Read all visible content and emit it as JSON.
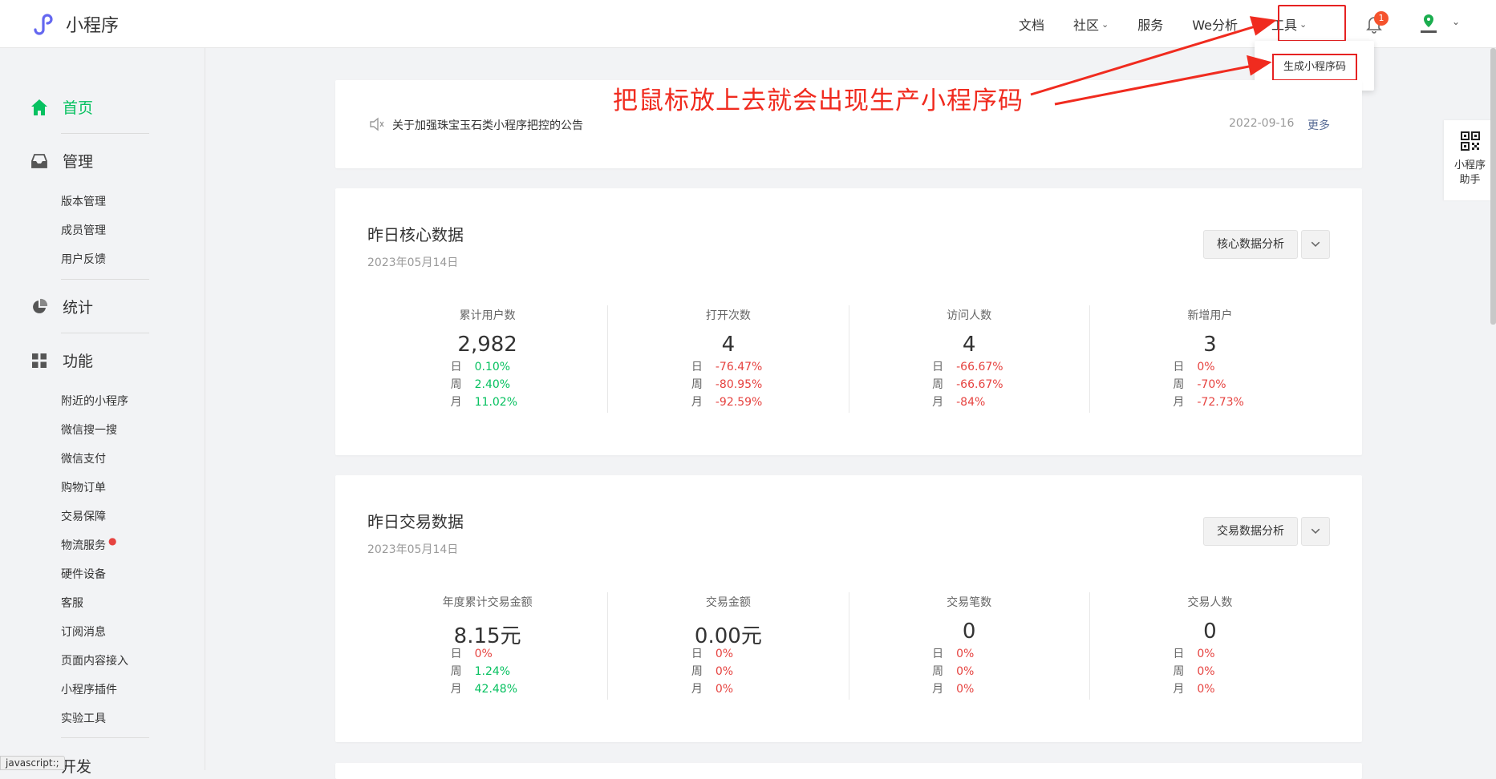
{
  "app": {
    "name": "小程序"
  },
  "nav": {
    "docs": "文档",
    "community": "社区",
    "service": "服务",
    "we_analysis": "We分析",
    "tools": "工具",
    "notification_count": "1"
  },
  "tools_menu": {
    "generate_qrcode": "生成小程序码"
  },
  "annotation": {
    "text": "把鼠标放上去就会出现生产小程序码",
    "color": "#f02b1f"
  },
  "sidebar": {
    "home": "首页",
    "manage": "管理",
    "manage_items": [
      "版本管理",
      "成员管理",
      "用户反馈"
    ],
    "stats": "统计",
    "features": "功能",
    "feature_items": [
      "附近的小程序",
      "微信搜一搜",
      "微信支付",
      "购物订单",
      "交易保障",
      "物流服务",
      "硬件设备",
      "客服",
      "订阅消息",
      "页面内容接入",
      "小程序插件",
      "实验工具"
    ],
    "develop": "开发"
  },
  "status_tip": "javascript:;",
  "notice": {
    "text": "关于加强珠宝玉石类小程序把控的公告",
    "date": "2022-09-16",
    "more": "更多"
  },
  "core": {
    "title": "昨日核心数据",
    "date": "2023年05月14日",
    "button": "核心数据分析",
    "metrics": [
      {
        "label": "累计用户数",
        "value": "2,982",
        "day": "0.10%",
        "week": "2.40%",
        "month": "11.02%",
        "dir": [
          "up",
          "up",
          "up"
        ]
      },
      {
        "label": "打开次数",
        "value": "4",
        "day": "-76.47%",
        "week": "-80.95%",
        "month": "-92.59%",
        "dir": [
          "down",
          "down",
          "down"
        ]
      },
      {
        "label": "访问人数",
        "value": "4",
        "day": "-66.67%",
        "week": "-66.67%",
        "month": "-84%",
        "dir": [
          "down",
          "down",
          "down"
        ]
      },
      {
        "label": "新增用户",
        "value": "3",
        "day": "0%",
        "week": "-70%",
        "month": "-72.73%",
        "dir": [
          "down",
          "down",
          "down"
        ]
      }
    ]
  },
  "trade": {
    "title": "昨日交易数据",
    "date": "2023年05月14日",
    "button": "交易数据分析",
    "metrics": [
      {
        "label": "年度累计交易金额",
        "value": "8.15元",
        "day": "0%",
        "week": "1.24%",
        "month": "42.48%",
        "dir": [
          "down",
          "up",
          "up"
        ]
      },
      {
        "label": "交易金额",
        "value": "0.00元",
        "day": "0%",
        "week": "0%",
        "month": "0%",
        "dir": [
          "down",
          "down",
          "down"
        ]
      },
      {
        "label": "交易笔数",
        "value": "0",
        "day": "0%",
        "week": "0%",
        "month": "0%",
        "dir": [
          "down",
          "down",
          "down"
        ]
      },
      {
        "label": "交易人数",
        "value": "0",
        "day": "0%",
        "week": "0%",
        "month": "0%",
        "dir": [
          "down",
          "down",
          "down"
        ]
      }
    ]
  },
  "period_labels": {
    "day": "日",
    "week": "周",
    "month": "月"
  },
  "float_panel": {
    "line1": "小程序",
    "line2": "助手"
  },
  "colors": {
    "accent_green": "#07c160",
    "negative_red": "#e64340",
    "highlight_red": "#e62222",
    "link_blue": "#576b95"
  }
}
